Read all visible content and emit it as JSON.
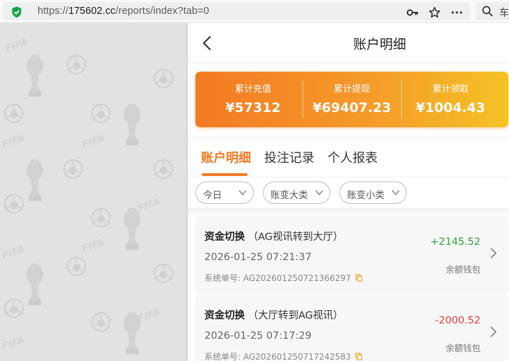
{
  "browser": {
    "url_prefix": "https://",
    "url_host": "175602.cc",
    "url_path": "/reports/index?tab=0",
    "search_text": "车"
  },
  "page": {
    "title": "账户明细"
  },
  "summary": [
    {
      "label": "累计充值",
      "value": "¥57312"
    },
    {
      "label": "累计提现",
      "value": "¥69407.23"
    },
    {
      "label": "累计领取",
      "value": "¥1004.43"
    }
  ],
  "tabs": [
    {
      "label": "账户明细",
      "active": true
    },
    {
      "label": "投注记录",
      "active": false
    },
    {
      "label": "个人报表",
      "active": false
    }
  ],
  "filters": [
    {
      "label": "今日"
    },
    {
      "label": "账变大类"
    },
    {
      "label": "账变小类"
    }
  ],
  "records": [
    {
      "type": "资金切换",
      "detail": "（AG视讯转到大厅）",
      "datetime": "2026-01-25 07:21:37",
      "order_label": "系统单号:",
      "order_no": "AG202601250721366297",
      "amount": "+2145.52",
      "wallet": "余额钱包"
    },
    {
      "type": "资金切换",
      "detail": "（大厅转到AG视讯）",
      "datetime": "2026-01-25 07:17:29",
      "order_label": "系统单号:",
      "order_no": "AG202601250717242583",
      "amount": "-2000.52",
      "wallet": "余额钱包"
    }
  ],
  "colors": {
    "accent": "#f47a23",
    "positive": "#2aa63a",
    "negative": "#e23b3b"
  },
  "icons": [
    "shield-icon",
    "key-icon",
    "star-icon",
    "more-icon",
    "search-icon",
    "back-icon",
    "chevron-down-icon",
    "copy-icon",
    "chevron-right-icon",
    "fifa-trophy-icon",
    "soccer-ball-icon"
  ]
}
